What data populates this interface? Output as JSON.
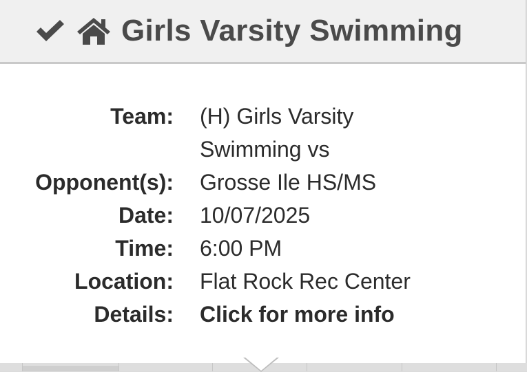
{
  "header": {
    "title": "Girls Varsity Swimming",
    "icons": [
      "check-icon",
      "home-icon"
    ]
  },
  "details": [
    {
      "label": "Team:",
      "value": "(H) Girls Varsity",
      "value_line2": "Swimming vs"
    },
    {
      "label": "Opponent(s):",
      "value": "Grosse Ile HS/MS"
    },
    {
      "label": "Date:",
      "value": "10/07/2025"
    },
    {
      "label": "Time:",
      "value": "6:00 PM"
    },
    {
      "label": "Location:",
      "value": "Flat Rock Rec Center"
    },
    {
      "label": "Details:",
      "value": "Click for more info"
    }
  ],
  "colors": {
    "header_bg": "#f0f0f0",
    "title_text": "#4a4a4a",
    "body_text": "#2b2b2b"
  }
}
